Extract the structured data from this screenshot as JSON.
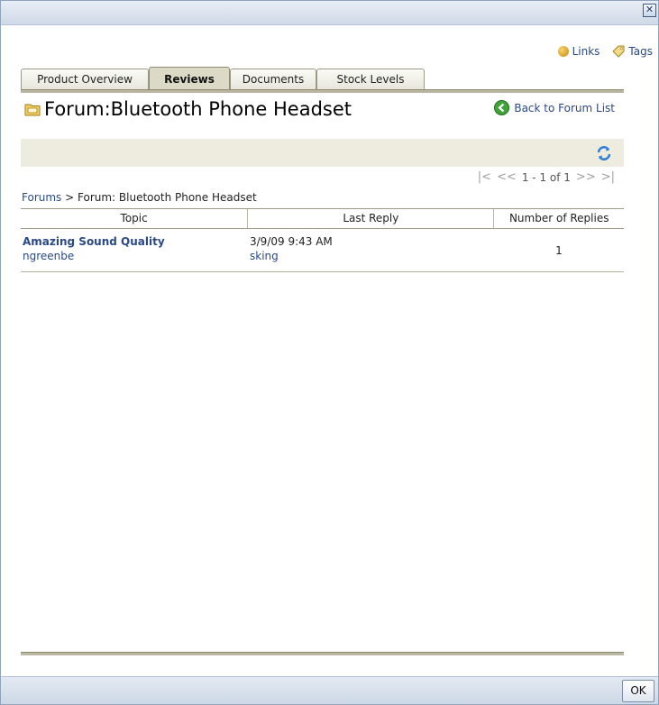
{
  "toplinks": {
    "links_label": "Links",
    "tags_label": "Tags"
  },
  "tabs": [
    {
      "label": "Product Overview"
    },
    {
      "label": "Reviews"
    },
    {
      "label": "Documents"
    },
    {
      "label": "Stock Levels"
    }
  ],
  "forum": {
    "title": "Forum:Bluetooth Phone Headset",
    "back_label": "Back to Forum List"
  },
  "pager": {
    "text": "1 - 1 of 1"
  },
  "breadcrumb": {
    "root": "Forums",
    "separator": ">",
    "current": "Forum: Bluetooth Phone Headset"
  },
  "grid": {
    "columns": [
      "Topic",
      "Last Reply",
      "Number of Replies"
    ],
    "rows": [
      {
        "topic": "Amazing Sound Quality",
        "author": "ngreenbe",
        "last_reply": "3/9/09 9:43 AM",
        "last_author": "sking",
        "replies": "1"
      }
    ]
  },
  "footer": {
    "ok_label": "OK"
  },
  "colors": {
    "link": "#2a4a85",
    "tab_active": "#dcd9c6",
    "toolbar": "#eeecdf"
  }
}
